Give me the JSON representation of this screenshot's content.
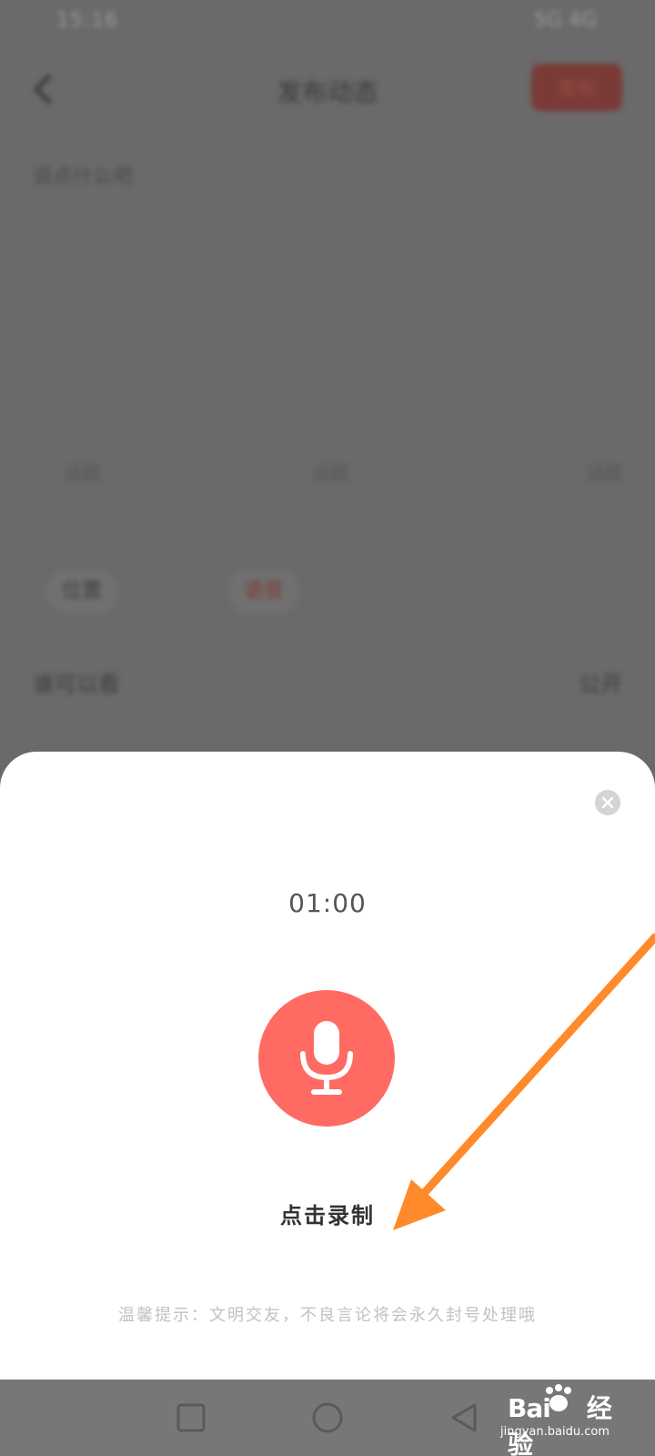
{
  "status_bar": {
    "time": "15:16",
    "network": "5G 4G"
  },
  "header": {
    "title": "发布动态",
    "publish_label": "发布"
  },
  "compose": {
    "placeholder": "说点什么吧"
  },
  "topics": [
    "话题",
    "话题",
    "话题"
  ],
  "tools": {
    "location_label": "位置",
    "voice_label": "语音"
  },
  "permission": {
    "label": "谁可以看",
    "value": "公开"
  },
  "recorder": {
    "timer": "01:00",
    "record_label": "点击录制",
    "tip": "温馨提示：文明交友，不良言论将会永久封号处理哦"
  },
  "watermark": {
    "logo_text": "Bai",
    "logo_suffix": "经验",
    "url": "jingyan.baidu.com"
  },
  "colors": {
    "accent": "#ff6b62",
    "annotation_arrow": "#ff8a2b",
    "overlay": "#6a6a6a",
    "sheet": "#ffffff"
  }
}
